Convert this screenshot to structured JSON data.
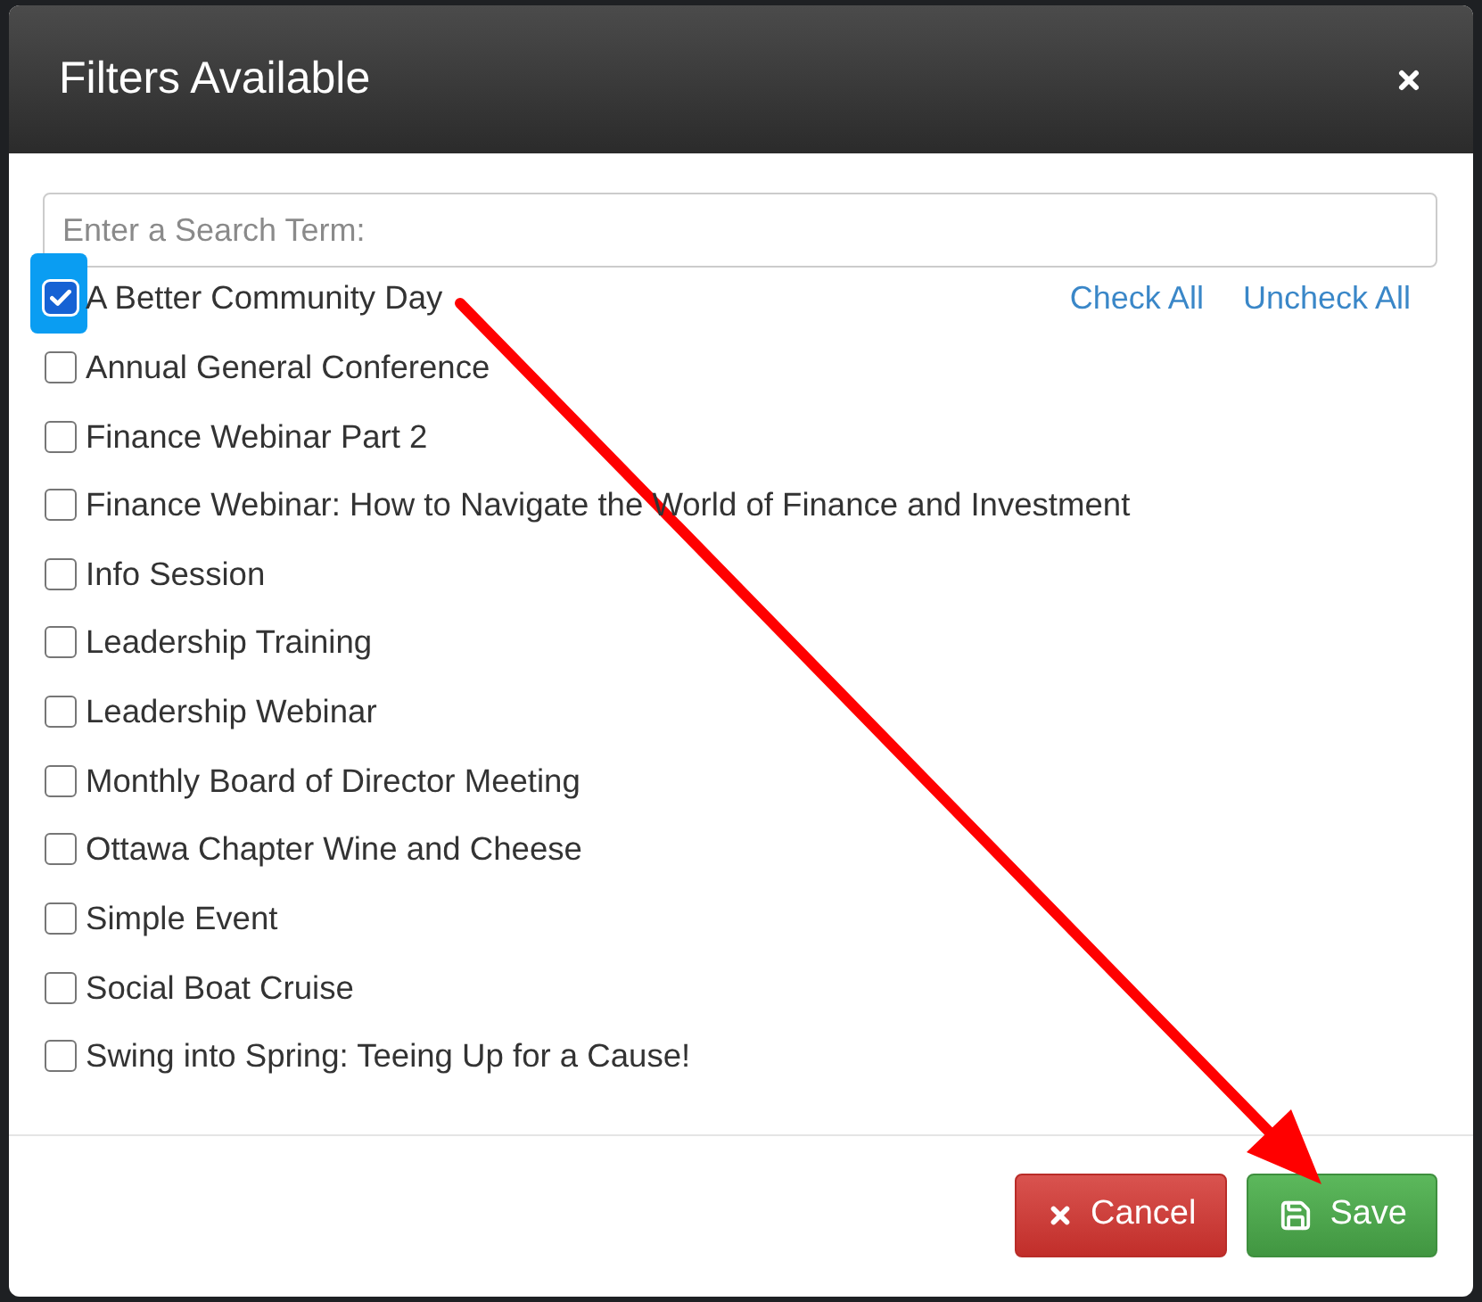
{
  "dialog": {
    "title": "Filters Available"
  },
  "search": {
    "placeholder": "Enter a Search Term:"
  },
  "links": [
    "Check All",
    "Uncheck All"
  ],
  "filters": [
    {
      "label": "A Better Community Day",
      "checked": true,
      "highlighted": true
    },
    {
      "label": "Annual General Conference",
      "checked": false,
      "highlighted": false
    },
    {
      "label": "Finance Webinar Part 2",
      "checked": false,
      "highlighted": false
    },
    {
      "label": "Finance Webinar: How to Navigate the World of Finance and Investment",
      "checked": false,
      "highlighted": false
    },
    {
      "label": "Info Session",
      "checked": false,
      "highlighted": false
    },
    {
      "label": "Leadership Training",
      "checked": false,
      "highlighted": false
    },
    {
      "label": "Leadership Webinar",
      "checked": false,
      "highlighted": false
    },
    {
      "label": "Monthly Board of Director Meeting",
      "checked": false,
      "highlighted": false
    },
    {
      "label": "Ottawa Chapter Wine and Cheese",
      "checked": false,
      "highlighted": false
    },
    {
      "label": "Simple Event",
      "checked": false,
      "highlighted": false
    },
    {
      "label": "Social Boat Cruise",
      "checked": false,
      "highlighted": false
    },
    {
      "label": "Swing into Spring: Teeing Up for a Cause!",
      "checked": false,
      "highlighted": false
    }
  ],
  "buttons": [
    {
      "label": "Cancel",
      "kind": "cancel"
    },
    {
      "label": "Save",
      "kind": "save"
    }
  ],
  "annotations": [
    {
      "kind": "arrow"
    }
  ]
}
